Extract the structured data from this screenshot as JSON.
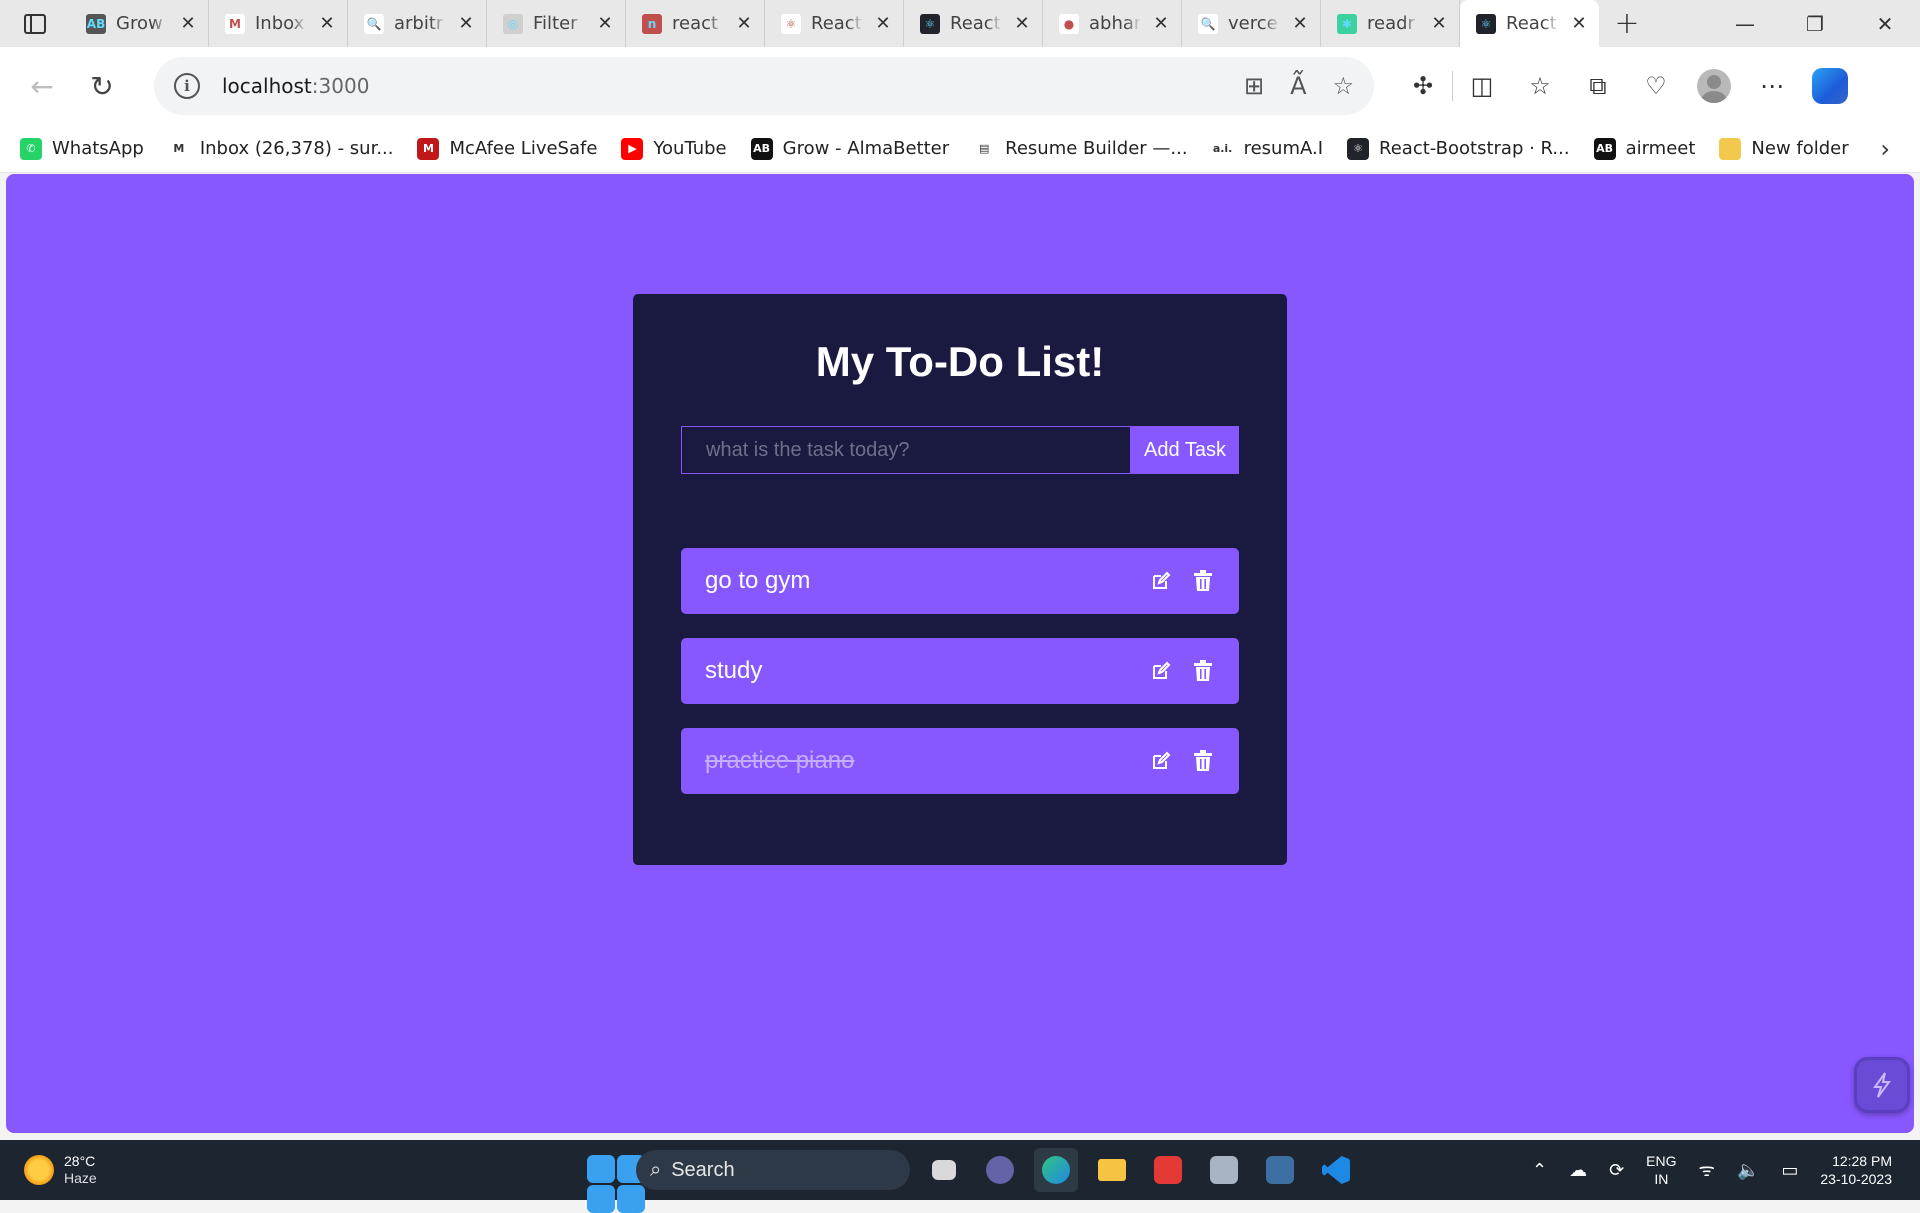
{
  "browser": {
    "tabs": [
      {
        "title": "Grow",
        "color": "#555555",
        "glyph": "AB"
      },
      {
        "title": "Inbox",
        "color": "#ffffff",
        "glyph": "M"
      },
      {
        "title": "arbitr",
        "color": "#ffffff",
        "glyph": "🔍"
      },
      {
        "title": "Filter",
        "color": "#cfcfcf",
        "glyph": "◎"
      },
      {
        "title": "react",
        "color": "#c0504d",
        "glyph": "n"
      },
      {
        "title": "React",
        "color": "#ffffff",
        "glyph": "⚛"
      },
      {
        "title": "React",
        "color": "#20232a",
        "glyph": "⚛"
      },
      {
        "title": "abhar",
        "color": "#ffffff",
        "glyph": "●"
      },
      {
        "title": "verce",
        "color": "#ffffff",
        "glyph": "🔍"
      },
      {
        "title": "readr",
        "color": "#3ad29f",
        "glyph": "✱"
      },
      {
        "title": "React",
        "color": "#20232a",
        "glyph": "⚛"
      }
    ],
    "active_tab": 10,
    "url_host": "localhost",
    "url_port": ":3000"
  },
  "bookmarks": [
    {
      "label": "WhatsApp",
      "color": "#25d366",
      "glyph": "✆"
    },
    {
      "label": "Inbox (26,378) - sur...",
      "color": "#ffffff",
      "glyph": "M"
    },
    {
      "label": "McAfee LiveSafe",
      "color": "#c01818",
      "glyph": "M"
    },
    {
      "label": "YouTube",
      "color": "#ff0000",
      "glyph": "▶"
    },
    {
      "label": "Grow - AlmaBetter",
      "color": "#111111",
      "glyph": "AB"
    },
    {
      "label": "Resume Builder —...",
      "color": "#ffffff",
      "glyph": "▤"
    },
    {
      "label": "resumA.I",
      "color": "#ffffff",
      "glyph": "a.i."
    },
    {
      "label": "React-Bootstrap · R...",
      "color": "#20232a",
      "glyph": "⚛"
    },
    {
      "label": "airmeet",
      "color": "#111111",
      "glyph": "AB"
    },
    {
      "label": "New folder",
      "color": "#f2c94c",
      "glyph": ""
    }
  ],
  "app": {
    "title": "My To-Do List!",
    "input_placeholder": "what is the task today?",
    "add_button": "Add Task",
    "tasks": [
      {
        "text": "go to gym",
        "completed": false
      },
      {
        "text": "study",
        "completed": false
      },
      {
        "text": "practice piano",
        "completed": true
      }
    ],
    "colors": {
      "background": "#8758ff",
      "card": "#1a1a40"
    }
  },
  "taskbar": {
    "temperature": "28°C",
    "condition": "Haze",
    "search_label": "Search",
    "lang_top": "ENG",
    "lang_bottom": "IN",
    "time": "12:28 PM",
    "date": "23-10-2023"
  }
}
